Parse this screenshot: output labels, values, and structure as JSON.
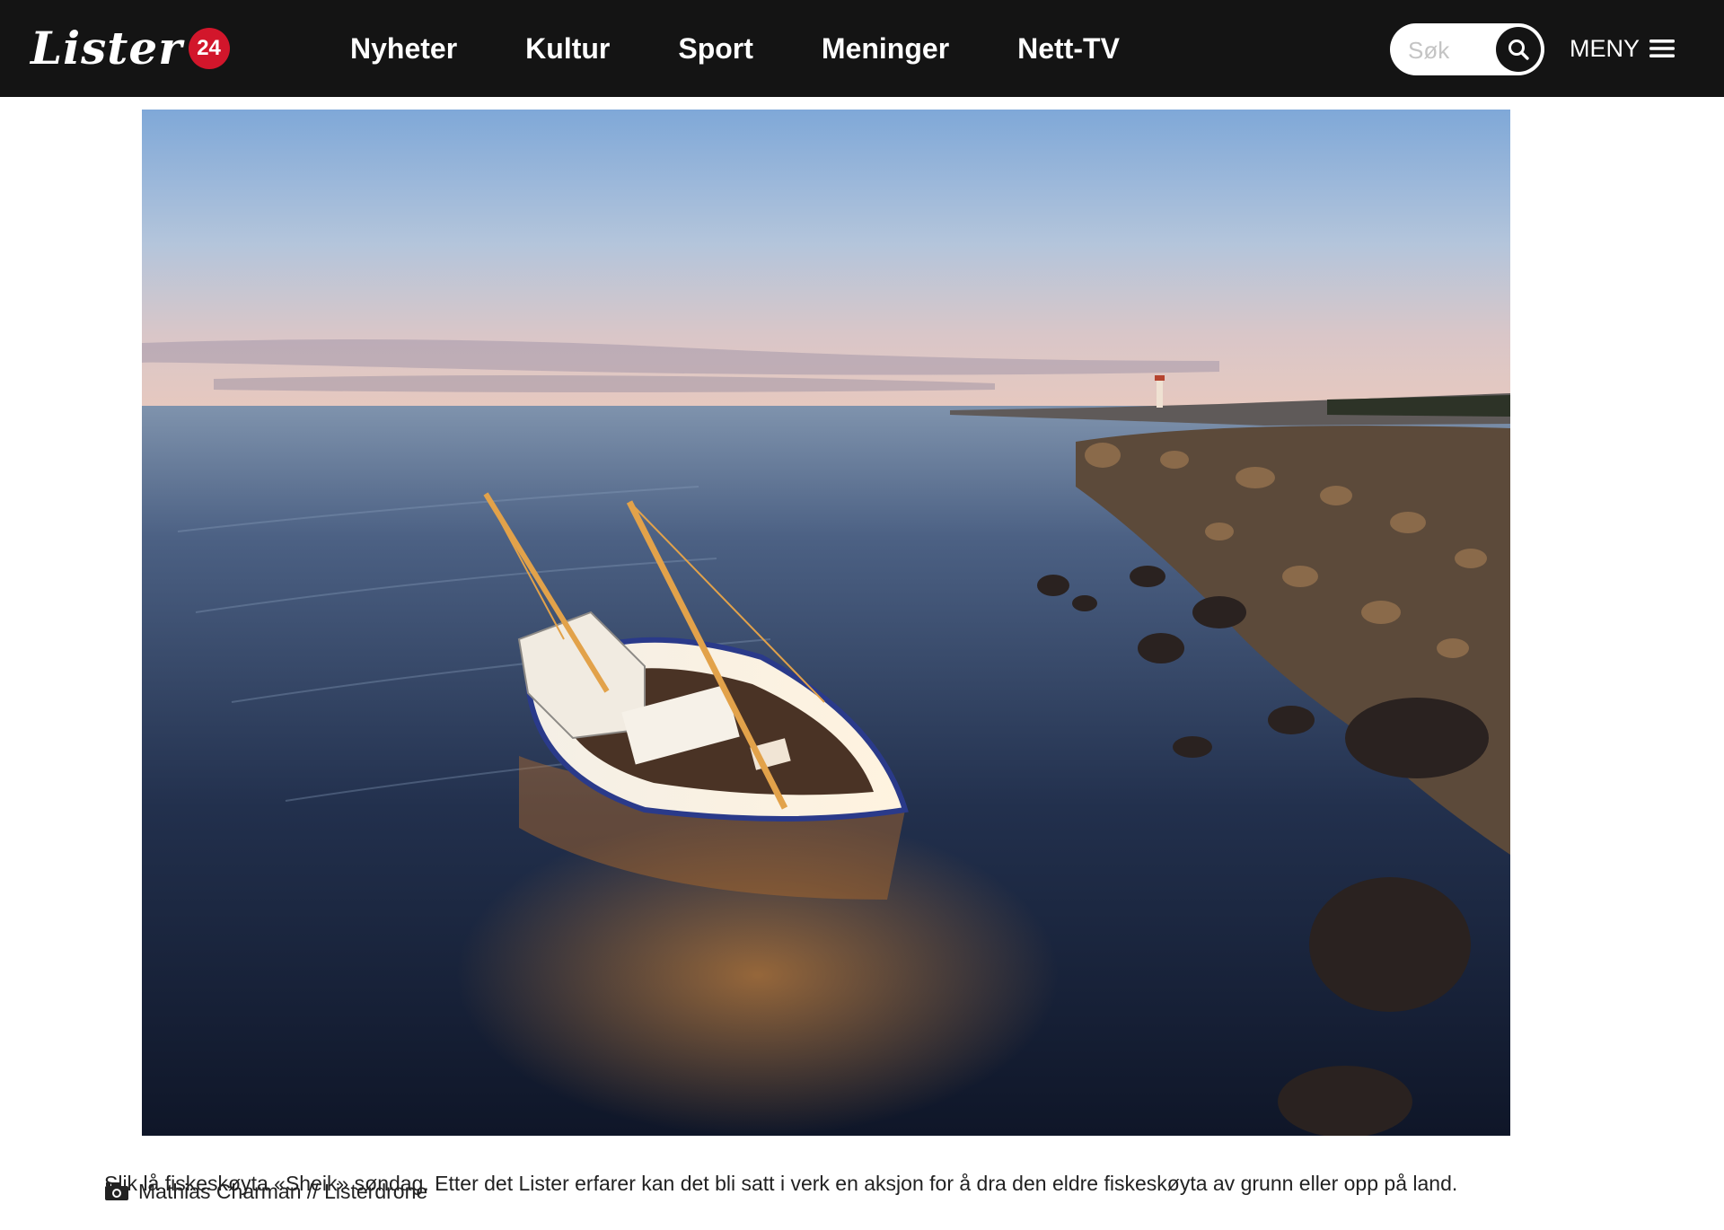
{
  "header": {
    "logo": {
      "text": "Lister",
      "badge": "24"
    },
    "nav": [
      {
        "label": "Nyheter"
      },
      {
        "label": "Kultur"
      },
      {
        "label": "Sport"
      },
      {
        "label": "Meninger"
      },
      {
        "label": "Nett-TV"
      }
    ],
    "search": {
      "placeholder": "Søk",
      "icon": "search-icon"
    },
    "menu": {
      "label": "MENY",
      "icon": "hamburger-icon"
    }
  },
  "article": {
    "image": {
      "subject": "fishing boat aground near rocky shore at sunset"
    },
    "caption": "Slik lå fiskeskøyta «Sheik» søndag. Etter det Lister erfarer kan det bli satt i verk en aksjon for å dra den eldre fiskeskøyta av grunn eller opp på land.",
    "credit": {
      "icon": "camera-icon",
      "text": "Mathias Charman // Listerdrone"
    }
  },
  "colors": {
    "header_bg": "#141414",
    "badge_red": "#d2162b",
    "text": "#222222"
  }
}
